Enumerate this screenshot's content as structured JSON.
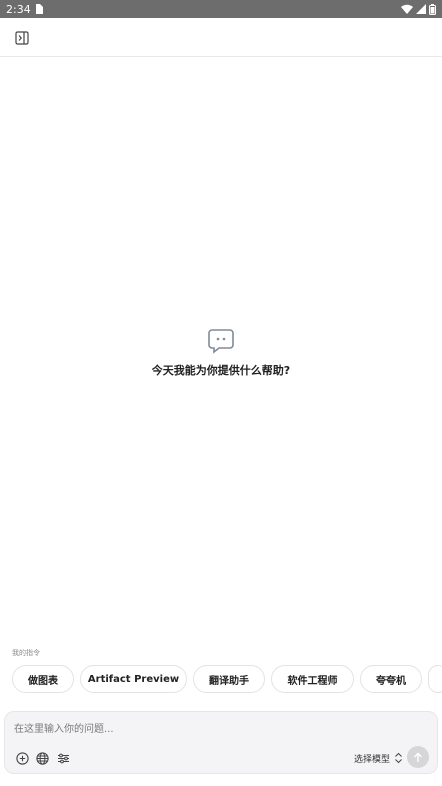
{
  "status_bar": {
    "time": "2:34"
  },
  "empty_state": {
    "title": "今天我能为你提供什么帮助?"
  },
  "suggestions": {
    "label": "我的指令",
    "chips": [
      "做图表",
      "Artifact Preview",
      "翻译助手",
      "软件工程师",
      "夸夸机",
      ""
    ]
  },
  "composer": {
    "placeholder": "在这里输入你的问题...",
    "model_label": "选择模型"
  },
  "icons": {
    "sidebar_toggle": "sidebar-toggle-icon",
    "empty": "chat-bubble-icon",
    "attach": "plus-circle-icon",
    "web": "globe-icon",
    "settings": "sliders-icon",
    "model_chevrons": "chevron-up-down-icon",
    "send": "arrow-up-icon"
  },
  "colors": {
    "status_bar": "#6d6d6d",
    "composer_bg": "#f4f4f6",
    "send_button": "#d6d6d9"
  }
}
